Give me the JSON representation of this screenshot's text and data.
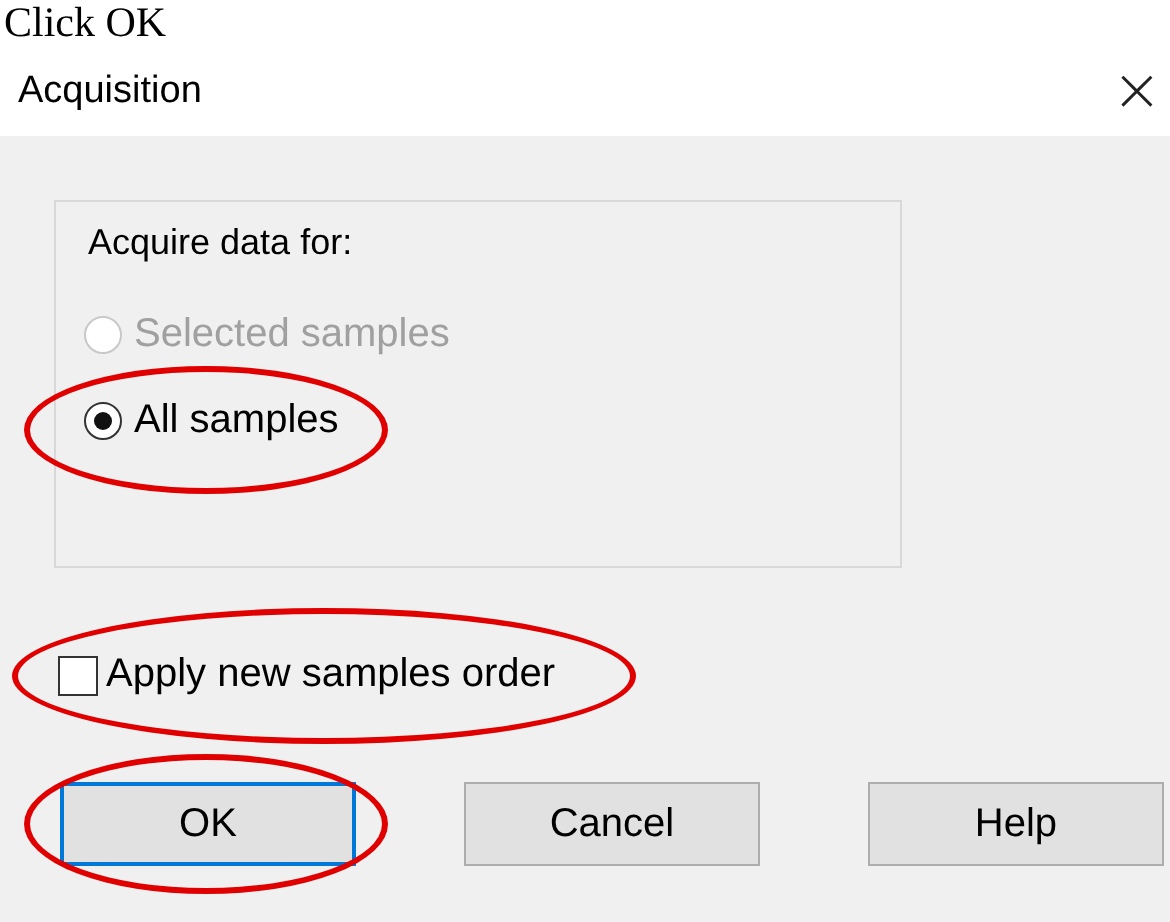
{
  "caption": "Click OK",
  "window": {
    "title": "Acquisition",
    "close": "×"
  },
  "group": {
    "label": "Acquire data for:",
    "options": [
      {
        "label": "Selected samples",
        "selected": false,
        "disabled": true,
        "circled": false
      },
      {
        "label": "All samples",
        "selected": true,
        "disabled": false,
        "circled": true
      }
    ]
  },
  "checkbox": {
    "label": "Apply new samples order",
    "checked": false,
    "circled": true
  },
  "buttons": [
    {
      "label": "OK",
      "focused": true,
      "circled": true
    },
    {
      "label": "Cancel",
      "focused": false,
      "circled": false
    },
    {
      "label": "Help",
      "focused": false,
      "circled": false
    }
  ]
}
